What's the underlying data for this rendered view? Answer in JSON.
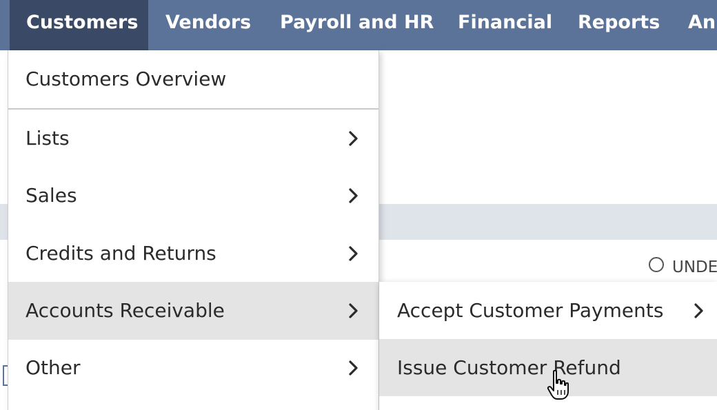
{
  "nav": {
    "tabs": [
      {
        "label": "Customers",
        "active": true
      },
      {
        "label": "Vendors"
      },
      {
        "label": "Payroll and HR"
      },
      {
        "label": "Financial"
      },
      {
        "label": "Reports"
      },
      {
        "label": "An"
      }
    ]
  },
  "menu": {
    "items": [
      {
        "label": "Customers Overview",
        "has_submenu": false
      },
      {
        "label": "Lists",
        "has_submenu": true
      },
      {
        "label": "Sales",
        "has_submenu": true
      },
      {
        "label": "Credits and Returns",
        "has_submenu": true
      },
      {
        "label": "Accounts Receivable",
        "has_submenu": true,
        "highlighted": true
      },
      {
        "label": "Other",
        "has_submenu": true
      }
    ]
  },
  "submenu": {
    "items": [
      {
        "label": "Accept Customer Payments",
        "has_submenu": true
      },
      {
        "label": "Issue Customer Refund",
        "highlighted": true
      }
    ]
  },
  "background": {
    "radio_label": "UNDE"
  },
  "colors": {
    "nav_bg": "#5c7399",
    "nav_active": "#3a4a66",
    "highlight": "#e4e4e4"
  },
  "icons": {
    "chevron": "chevron-right-icon",
    "cursor": "hand-pointer-icon"
  }
}
